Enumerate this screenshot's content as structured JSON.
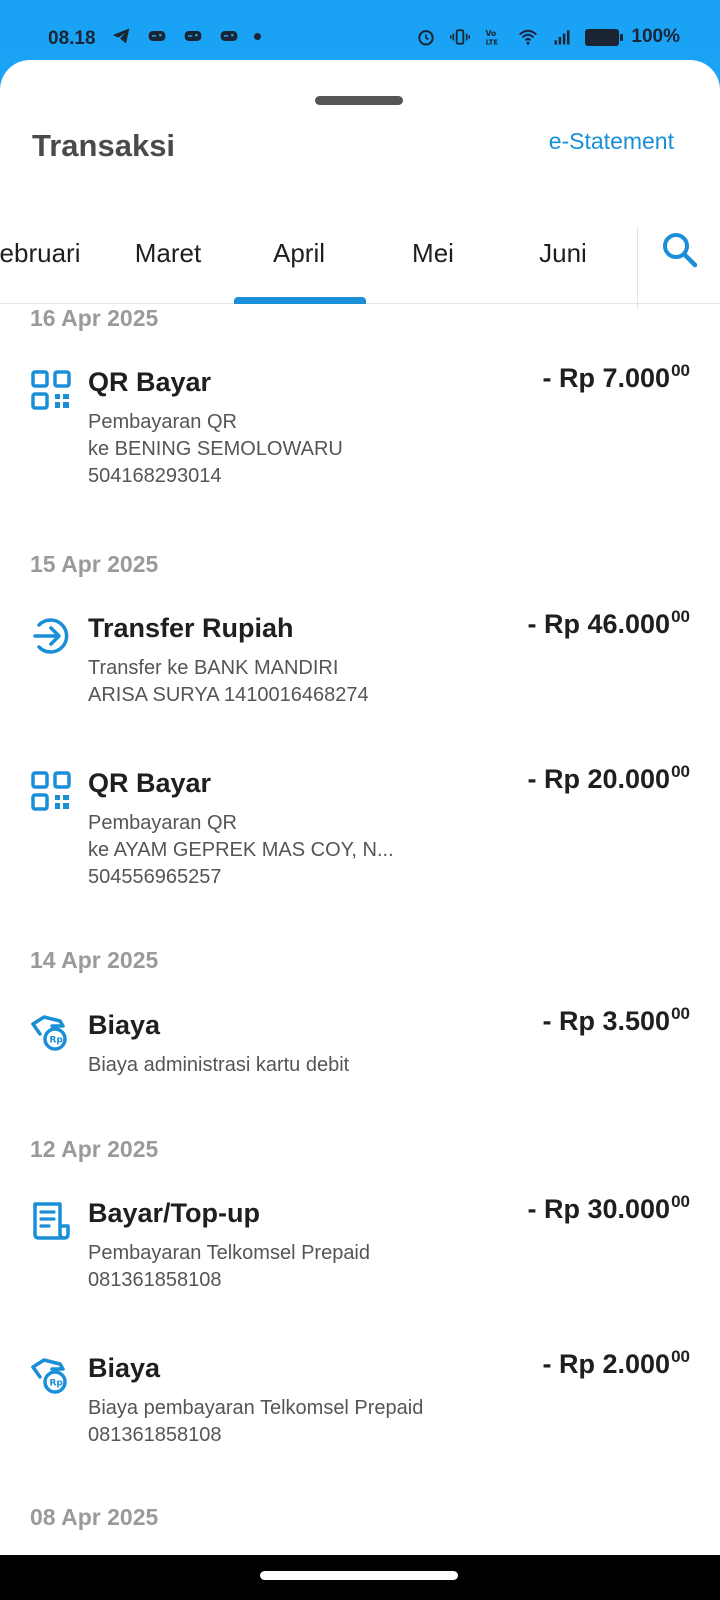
{
  "status_bar": {
    "time": "08.18",
    "battery": "100%",
    "left_icons": [
      "telegram-icon",
      "game-controller-icon",
      "game-controller-icon",
      "game-controller-icon",
      "notification-dot-icon"
    ],
    "right_icons": [
      "alarm-icon",
      "vibrate-icon",
      "volte-icon",
      "wifi-icon",
      "signal-icon",
      "battery-icon"
    ]
  },
  "header": {
    "title": "Transaksi",
    "estatement_label": "e-Statement"
  },
  "tabs": {
    "items": [
      "ebruari",
      "Maret",
      "April",
      "Mei",
      "Juni"
    ],
    "selected": "April",
    "search_icon": "search-icon"
  },
  "colors": {
    "accent": "#1a8fd8",
    "status_bar_bg": "#1aa3f5",
    "date_text": "#9a9a9a"
  },
  "groups": [
    {
      "date": "16 Apr 2025",
      "transactions": [
        {
          "icon": "qr-code-icon",
          "title": "QR Bayar",
          "amount": "- Rp 7.000",
          "amount_cents": "00",
          "desc": [
            "Pembayaran QR",
            "ke BENING SEMOLOWARU",
            "504168293014"
          ]
        }
      ]
    },
    {
      "date": "15 Apr 2025",
      "transactions": [
        {
          "icon": "transfer-arrow-icon",
          "title": "Transfer Rupiah",
          "amount": "- Rp 46.000",
          "amount_cents": "00",
          "desc": [
            "Transfer ke BANK MANDIRI",
            "ARISA SURYA 1410016468274"
          ]
        },
        {
          "icon": "qr-code-icon",
          "title": "QR Bayar",
          "amount": "- Rp 20.000",
          "amount_cents": "00",
          "desc": [
            "Pembayaran QR",
            "ke AYAM GEPREK MAS COY, N...",
            "504556965257"
          ]
        }
      ]
    },
    {
      "date": "14 Apr 2025",
      "transactions": [
        {
          "icon": "fee-hand-coin-icon",
          "title": "Biaya",
          "amount": "- Rp 3.500",
          "amount_cents": "00",
          "desc": [
            "Biaya administrasi kartu debit"
          ]
        }
      ]
    },
    {
      "date": "12 Apr 2025",
      "transactions": [
        {
          "icon": "bill-receipt-icon",
          "title": "Bayar/Top-up",
          "amount": "- Rp 30.000",
          "amount_cents": "00",
          "desc": [
            "Pembayaran Telkomsel Prepaid",
            "081361858108"
          ]
        },
        {
          "icon": "fee-hand-coin-icon",
          "title": "Biaya",
          "amount": "- Rp 2.000",
          "amount_cents": "00",
          "desc": [
            "Biaya pembayaran Telkomsel Prepaid",
            "081361858108"
          ]
        }
      ]
    },
    {
      "date": "08 Apr 2025",
      "transactions": []
    }
  ]
}
